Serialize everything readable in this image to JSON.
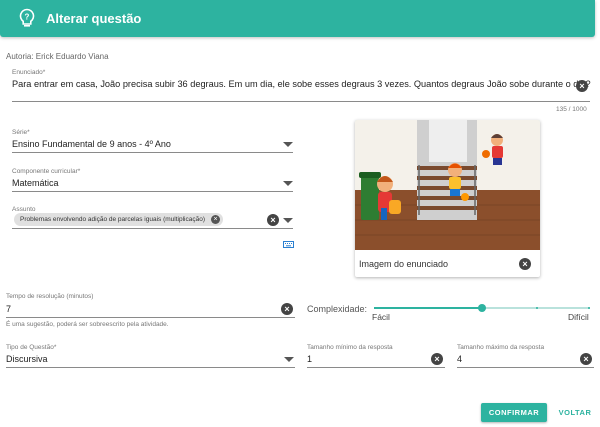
{
  "header": {
    "title": "Alterar questão",
    "icon": "question-lightbulb-icon",
    "color": "#2db3a0"
  },
  "author": "Autoria: Erick Eduardo Viana",
  "statement": {
    "label": "Enunciado*",
    "value": "Para entrar em casa, João precisa subir 36 degraus. Em um dia, ele sobe esses degraus 3 vezes. Quantos degraus João sobe durante o dia?",
    "counter": "135 / 1000"
  },
  "grade": {
    "label": "Série*",
    "value": "Ensino Fundamental de 9 anos - 4º Ano"
  },
  "component": {
    "label": "Componente curricular*",
    "value": "Matemática"
  },
  "subject": {
    "label": "Assunto",
    "chip": "Problemas envolvendo adição de parcelas iguais (multiplicação)"
  },
  "image_card": {
    "caption": "Imagem do enunciado"
  },
  "time": {
    "label": "Tempo de resolução (minutos)",
    "value": "7",
    "hint": "É uma sugestão, poderá ser sobreescrito pela atividade."
  },
  "complexity": {
    "label": "Complexidade:",
    "min_label": "Fácil",
    "max_label": "Difícil",
    "level": 0.5
  },
  "question_type": {
    "label": "Tipo de Questão*",
    "value": "Discursiva"
  },
  "min_size": {
    "label": "Tamanho mínimo da resposta",
    "value": "1"
  },
  "max_size": {
    "label": "Tamanho máximo da resposta",
    "value": "4"
  },
  "actions": {
    "confirm": "CONFIRMAR",
    "back": "VOLTAR"
  }
}
